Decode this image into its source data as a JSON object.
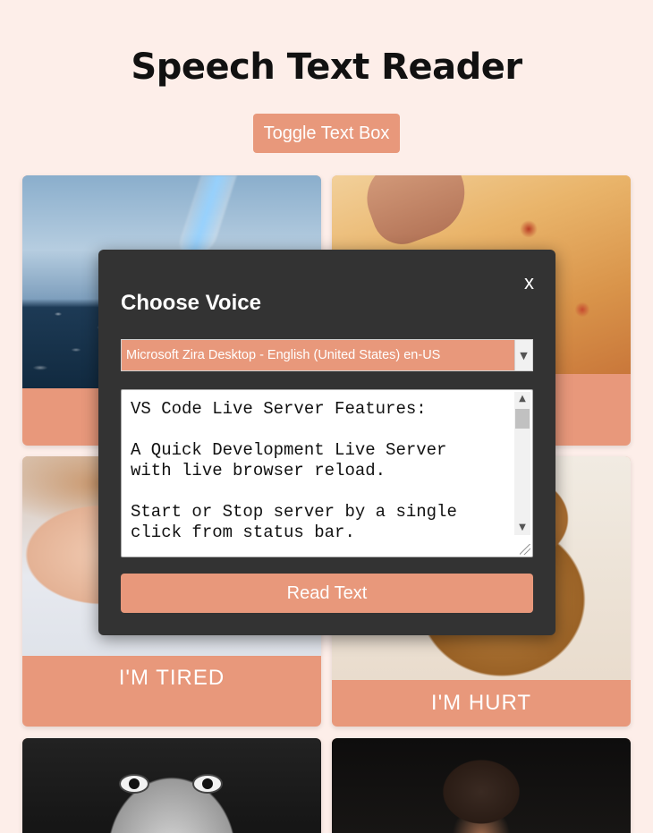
{
  "header": {
    "title": "Speech Text Reader"
  },
  "toolbar": {
    "toggle_label": "Toggle Text Box"
  },
  "cards": [
    {
      "label": "",
      "image": "water-pouring-image"
    },
    {
      "label": "",
      "image": "pizza-image"
    },
    {
      "label": "I'M TIRED",
      "image": "sleeping-child-image"
    },
    {
      "label": "I'M HURT",
      "image": "teddy-bear-image"
    },
    {
      "label": "",
      "image": "surprised-boy-image"
    },
    {
      "label": "",
      "image": "angry-kid-image"
    }
  ],
  "modal": {
    "close_label": "x",
    "title": "Choose Voice",
    "voice_selected": "Microsoft Zira Desktop - English (United States) en-US",
    "text_content": "VS Code Live Server Features:\n\nA Quick Development Live Server\nwith live browser reload.\n\nStart or Stop server by a single\nclick from status bar.",
    "read_label": "Read Text"
  },
  "colors": {
    "background": "#fdeee9",
    "accent": "#e8987b",
    "modal": "#333333"
  }
}
